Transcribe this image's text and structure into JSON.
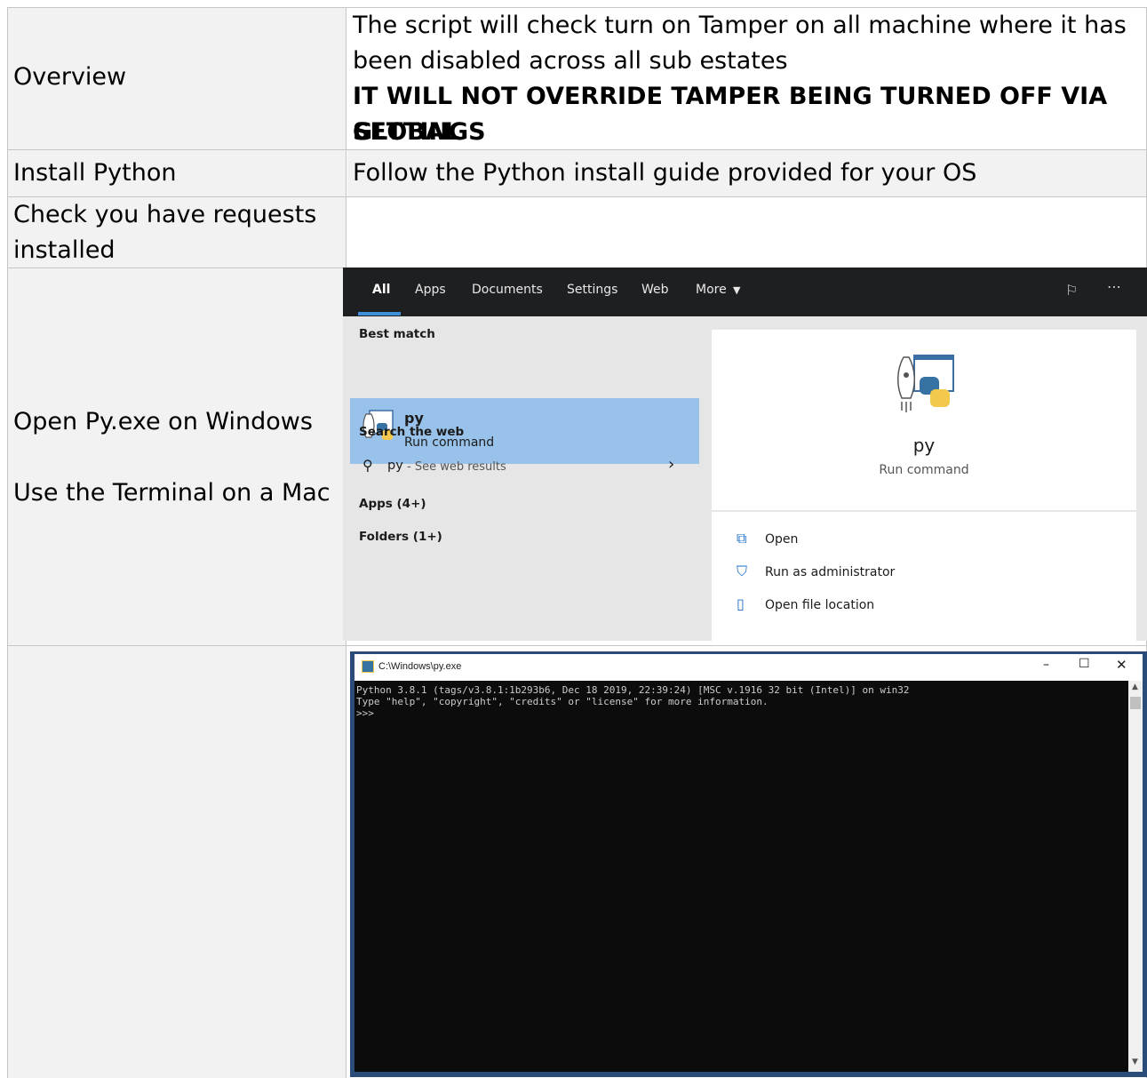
{
  "table": {
    "rows": [
      {
        "label": "Overview",
        "text1": "The script will check turn on Tamper on all machine where it has",
        "text2": "been disabled across all sub estates",
        "bold1": "IT WILL NOT OVERRIDE TAMPER BEING TURNED OFF VIA GLOBAL",
        "bold2": "SETTINGS"
      },
      {
        "label": "Install Python",
        "text": "Follow the Python install guide provided for your OS"
      },
      {
        "label1": "Check you have requests",
        "label2": "installed"
      },
      {
        "label1": "Open Py.exe on Windows",
        "label2": "Use the Terminal on a Mac"
      }
    ]
  },
  "search": {
    "tabs": [
      "All",
      "Apps",
      "Documents",
      "Settings",
      "Web",
      "More"
    ],
    "best_match": "Best match",
    "result_title": "py",
    "result_sub": "Run command",
    "search_web": "Search the web",
    "web_query": "py",
    "web_suffix": " - See web results",
    "apps": "Apps (4+)",
    "folders": "Folders (1+)",
    "detail_title": "py",
    "detail_sub": "Run command",
    "actions": [
      "Open",
      "Run as administrator",
      "Open file location"
    ]
  },
  "console": {
    "title": "C:\\Windows\\py.exe",
    "lines": [
      "Python 3.8.1 (tags/v3.8.1:1b293b6, Dec 18 2019, 22:39:24) [MSC v.1916 32 bit (Intel)] on win32",
      "Type \"help\", \"copyright\", \"credits\" or \"license\" for more information.",
      ">>>"
    ]
  },
  "colors": {
    "accent": "#3f8fd8",
    "selection": "#99c2ea",
    "console_bg": "#0c0c0c"
  }
}
